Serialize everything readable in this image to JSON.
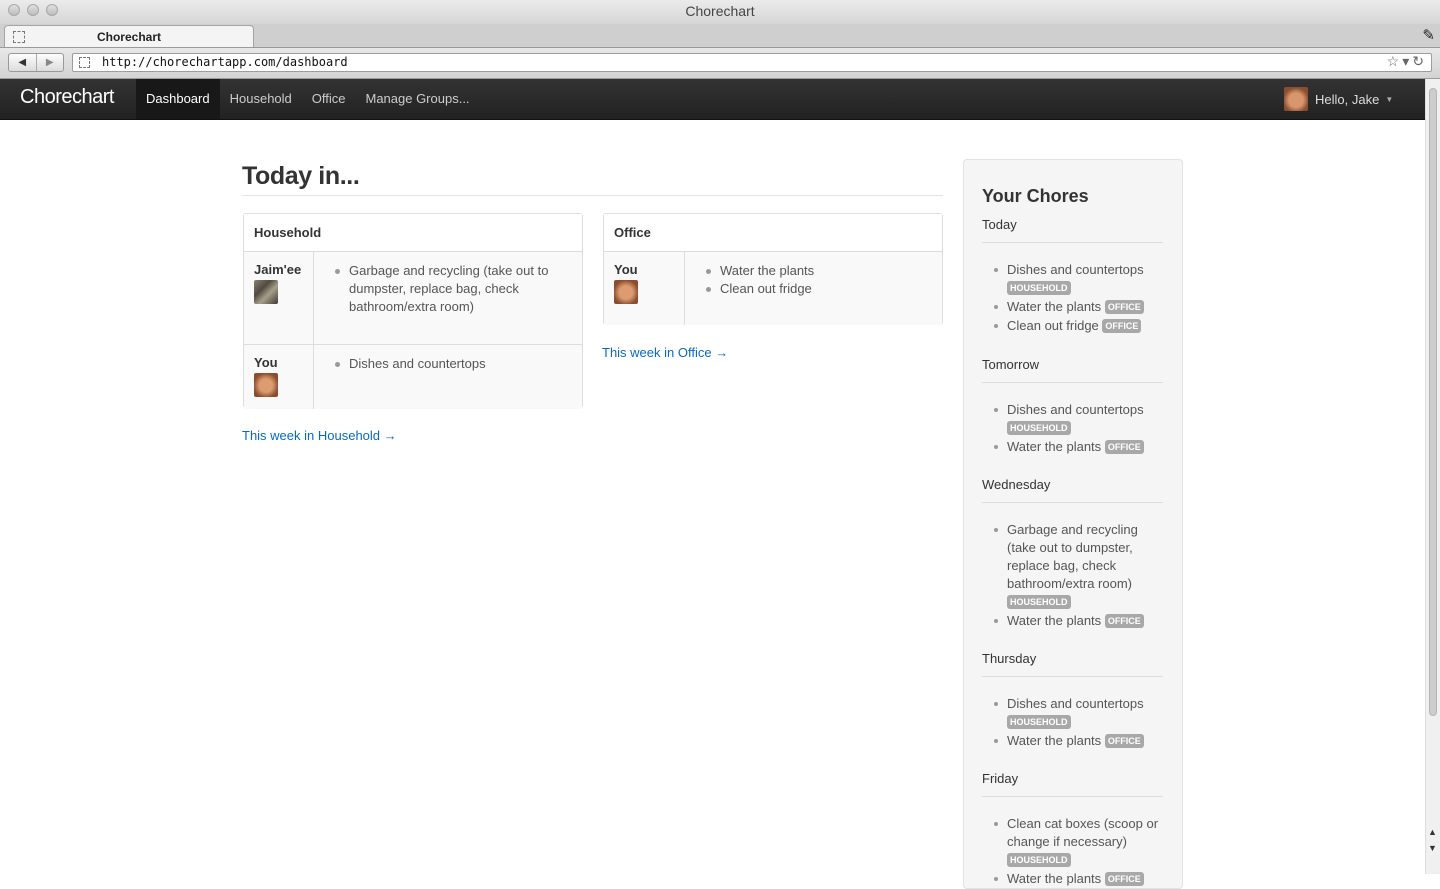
{
  "window": {
    "title": "Chorechart"
  },
  "browser": {
    "tab_title": "Chorechart",
    "url": "http://chorechartapp.com/dashboard"
  },
  "navbar": {
    "brand": "Chorechart",
    "items": [
      {
        "label": "Dashboard",
        "active": true
      },
      {
        "label": "Household",
        "active": false
      },
      {
        "label": "Office",
        "active": false
      },
      {
        "label": "Manage Groups...",
        "active": false
      }
    ],
    "user_greeting": "Hello, Jake"
  },
  "main": {
    "title": "Today in...",
    "groups": [
      {
        "name": "Household",
        "rows": [
          {
            "person": "Jaim'ee",
            "chores": [
              "Garbage and recycling (take out to dumpster, replace bag, check bathroom/extra room)"
            ]
          },
          {
            "person": "You",
            "chores": [
              "Dishes and countertops"
            ]
          }
        ],
        "week_link": "This week in Household →"
      },
      {
        "name": "Office",
        "rows": [
          {
            "person": "You",
            "chores": [
              "Water the plants",
              "Clean out fridge"
            ]
          }
        ],
        "week_link": "This week in Office →"
      }
    ]
  },
  "sidebar": {
    "title": "Your Chores",
    "days": [
      {
        "name": "Today",
        "chores": [
          {
            "text": "Dishes and countertops",
            "group": "HOUSEHOLD"
          },
          {
            "text": "Water the plants",
            "group": "OFFICE"
          },
          {
            "text": "Clean out fridge",
            "group": "OFFICE"
          }
        ]
      },
      {
        "name": "Tomorrow",
        "chores": [
          {
            "text": "Dishes and countertops",
            "group": "HOUSEHOLD"
          },
          {
            "text": "Water the plants",
            "group": "OFFICE"
          }
        ]
      },
      {
        "name": "Wednesday",
        "chores": [
          {
            "text": "Garbage and recycling (take out to dumpster, replace bag, check bathroom/extra room)",
            "group": "HOUSEHOLD"
          },
          {
            "text": "Water the plants",
            "group": "OFFICE"
          }
        ]
      },
      {
        "name": "Thursday",
        "chores": [
          {
            "text": "Dishes and countertops",
            "group": "HOUSEHOLD"
          },
          {
            "text": "Water the plants",
            "group": "OFFICE"
          }
        ]
      },
      {
        "name": "Friday",
        "chores": [
          {
            "text": "Clean cat boxes (scoop or change if necessary)",
            "group": "HOUSEHOLD"
          },
          {
            "text": "Water the plants",
            "group": "OFFICE"
          }
        ]
      }
    ]
  }
}
